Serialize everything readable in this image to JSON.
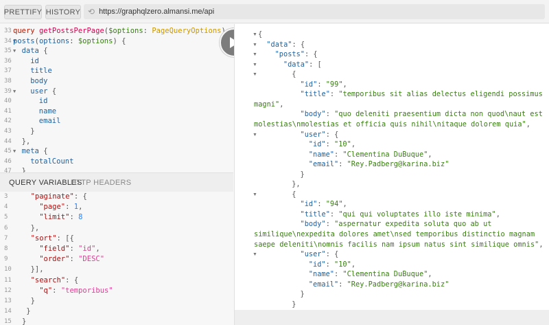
{
  "toolbar": {
    "prettify_label": "PRETTIFY",
    "history_label": "HISTORY",
    "url": "https://graphqlzero.almansi.me/api"
  },
  "query_editor": {
    "lines": [
      {
        "n": "33",
        "fold": "",
        "indent": 0,
        "segs": [
          {
            "c": "kw",
            "t": "query "
          },
          {
            "c": "def",
            "t": "getPostsPerPage"
          },
          {
            "c": "pun",
            "t": "("
          },
          {
            "c": "var",
            "t": "$options"
          },
          {
            "c": "pun",
            "t": ": "
          },
          {
            "c": "type",
            "t": "PageQueryOptions"
          },
          {
            "c": "pun",
            "t": ") {"
          }
        ]
      },
      {
        "n": "34",
        "fold": "▼",
        "indent": 0,
        "segs": [
          {
            "c": "prop",
            "t": "posts"
          },
          {
            "c": "pun",
            "t": "("
          },
          {
            "c": "prop",
            "t": "options"
          },
          {
            "c": "pun",
            "t": ": "
          },
          {
            "c": "var",
            "t": "$options"
          },
          {
            "c": "pun",
            "t": ") {"
          }
        ]
      },
      {
        "n": "35",
        "fold": "▼",
        "indent": 2,
        "segs": [
          {
            "c": "prop",
            "t": "data"
          },
          {
            "c": "pun",
            "t": " {"
          }
        ]
      },
      {
        "n": "36",
        "fold": "",
        "indent": 4,
        "segs": [
          {
            "c": "prop",
            "t": "id"
          }
        ]
      },
      {
        "n": "37",
        "fold": "",
        "indent": 4,
        "segs": [
          {
            "c": "prop",
            "t": "title"
          }
        ]
      },
      {
        "n": "38",
        "fold": "",
        "indent": 4,
        "segs": [
          {
            "c": "prop",
            "t": "body"
          }
        ]
      },
      {
        "n": "39",
        "fold": "▼",
        "indent": 4,
        "segs": [
          {
            "c": "prop",
            "t": "user"
          },
          {
            "c": "pun",
            "t": " {"
          }
        ]
      },
      {
        "n": "40",
        "fold": "",
        "indent": 6,
        "segs": [
          {
            "c": "prop",
            "t": "id"
          }
        ]
      },
      {
        "n": "41",
        "fold": "",
        "indent": 6,
        "segs": [
          {
            "c": "prop",
            "t": "name"
          }
        ]
      },
      {
        "n": "42",
        "fold": "",
        "indent": 6,
        "segs": [
          {
            "c": "prop",
            "t": "email"
          }
        ]
      },
      {
        "n": "43",
        "fold": "",
        "indent": 4,
        "segs": [
          {
            "c": "pun",
            "t": "}"
          }
        ]
      },
      {
        "n": "44",
        "fold": "",
        "indent": 2,
        "segs": [
          {
            "c": "pun",
            "t": "},"
          }
        ]
      },
      {
        "n": "45",
        "fold": "▼",
        "indent": 2,
        "segs": [
          {
            "c": "prop",
            "t": "meta"
          },
          {
            "c": "pun",
            "t": " {"
          }
        ]
      },
      {
        "n": "46",
        "fold": "",
        "indent": 4,
        "segs": [
          {
            "c": "prop",
            "t": "totalCount"
          }
        ]
      },
      {
        "n": "47",
        "fold": "",
        "indent": 2,
        "segs": [
          {
            "c": "pun",
            "t": "}"
          }
        ]
      }
    ]
  },
  "variables": {
    "tab_active": "QUERY VARIABLES",
    "tab_inactive": "HTTP HEADERS",
    "lines": [
      {
        "n": "3",
        "fold": "",
        "indent": 2,
        "segs": [
          {
            "c": "jkey",
            "t": "\"paginate\""
          },
          {
            "c": "pun",
            "t": ": {"
          }
        ]
      },
      {
        "n": "4",
        "fold": "",
        "indent": 4,
        "segs": [
          {
            "c": "jkey",
            "t": "\"page\""
          },
          {
            "c": "pun",
            "t": ": "
          },
          {
            "c": "num",
            "t": "1"
          },
          {
            "c": "pun",
            "t": ","
          }
        ]
      },
      {
        "n": "5",
        "fold": "",
        "indent": 4,
        "segs": [
          {
            "c": "jkey",
            "t": "\"limit\""
          },
          {
            "c": "pun",
            "t": ": "
          },
          {
            "c": "num",
            "t": "8"
          }
        ]
      },
      {
        "n": "6",
        "fold": "",
        "indent": 2,
        "segs": [
          {
            "c": "pun",
            "t": "},"
          }
        ]
      },
      {
        "n": "7",
        "fold": "",
        "indent": 2,
        "segs": [
          {
            "c": "jkey",
            "t": "\"sort\""
          },
          {
            "c": "pun",
            "t": ": [{"
          }
        ]
      },
      {
        "n": "8",
        "fold": "",
        "indent": 4,
        "segs": [
          {
            "c": "jkey",
            "t": "\"field\""
          },
          {
            "c": "pun",
            "t": ": "
          },
          {
            "c": "str",
            "t": "\"id\""
          },
          {
            "c": "pun",
            "t": ","
          }
        ]
      },
      {
        "n": "9",
        "fold": "",
        "indent": 4,
        "segs": [
          {
            "c": "jkey",
            "t": "\"order\""
          },
          {
            "c": "pun",
            "t": ": "
          },
          {
            "c": "str",
            "t": "\"DESC\""
          }
        ]
      },
      {
        "n": "10",
        "fold": "",
        "indent": 2,
        "segs": [
          {
            "c": "pun",
            "t": "}],"
          }
        ]
      },
      {
        "n": "11",
        "fold": "",
        "indent": 2,
        "segs": [
          {
            "c": "jkey",
            "t": "\"search\""
          },
          {
            "c": "pun",
            "t": ": {"
          }
        ]
      },
      {
        "n": "12",
        "fold": "",
        "indent": 4,
        "segs": [
          {
            "c": "jkey",
            "t": "\"q\""
          },
          {
            "c": "pun",
            "t": ": "
          },
          {
            "c": "str",
            "t": "\"temporibus\""
          }
        ]
      },
      {
        "n": "13",
        "fold": "",
        "indent": 2,
        "segs": [
          {
            "c": "pun",
            "t": "}"
          }
        ]
      },
      {
        "n": "14",
        "fold": "",
        "indent": 1,
        "segs": [
          {
            "c": "pun",
            "t": "}"
          }
        ]
      },
      {
        "n": "15",
        "fold": "",
        "indent": 0,
        "segs": [
          {
            "c": "pun",
            "t": "}"
          }
        ]
      }
    ]
  },
  "result": {
    "lines": [
      {
        "fold": "▼",
        "indent": 0,
        "segs": [
          {
            "c": "pun",
            "t": "{"
          }
        ]
      },
      {
        "fold": "▼",
        "indent": 1,
        "segs": [
          {
            "c": "rkey",
            "t": "\"data\""
          },
          {
            "c": "pun",
            "t": ": {"
          }
        ]
      },
      {
        "fold": "▼",
        "indent": 2,
        "segs": [
          {
            "c": "rkey",
            "t": "\"posts\""
          },
          {
            "c": "pun",
            "t": ": {"
          }
        ]
      },
      {
        "fold": "▼",
        "indent": 3,
        "segs": [
          {
            "c": "rkey",
            "t": "\"data\""
          },
          {
            "c": "pun",
            "t": ": ["
          }
        ]
      },
      {
        "fold": "▼",
        "indent": 4,
        "segs": [
          {
            "c": "pun",
            "t": "{"
          }
        ]
      },
      {
        "fold": "",
        "indent": 5,
        "segs": [
          {
            "c": "rkey",
            "t": "\"id\""
          },
          {
            "c": "pun",
            "t": ": "
          },
          {
            "c": "rstr",
            "t": "\"99\""
          },
          {
            "c": "pun",
            "t": ","
          }
        ]
      },
      {
        "fold": "",
        "indent": 5,
        "segs": [
          {
            "c": "rkey",
            "t": "\"title\""
          },
          {
            "c": "pun",
            "t": ": "
          },
          {
            "c": "rstr",
            "t": "\"temporibus sit alias delectus eligendi possimus"
          }
        ]
      },
      {
        "fold": "",
        "indent": -1,
        "segs": [
          {
            "c": "rstr",
            "t": "magni\""
          },
          {
            "c": "pun",
            "t": ","
          }
        ]
      },
      {
        "fold": "",
        "indent": 5,
        "segs": [
          {
            "c": "rkey",
            "t": "\"body\""
          },
          {
            "c": "pun",
            "t": ": "
          },
          {
            "c": "rstr",
            "t": "\"quo deleniti praesentium dicta non quod\\naut est"
          }
        ]
      },
      {
        "fold": "",
        "indent": -1,
        "segs": [
          {
            "c": "rstr",
            "t": "molestias\\nmolestias et officia quis nihil\\nitaque dolorem quia\""
          },
          {
            "c": "pun",
            "t": ","
          }
        ]
      },
      {
        "fold": "▼",
        "indent": 5,
        "segs": [
          {
            "c": "rkey",
            "t": "\"user\""
          },
          {
            "c": "pun",
            "t": ": {"
          }
        ]
      },
      {
        "fold": "",
        "indent": 6,
        "segs": [
          {
            "c": "rkey",
            "t": "\"id\""
          },
          {
            "c": "pun",
            "t": ": "
          },
          {
            "c": "rstr",
            "t": "\"10\""
          },
          {
            "c": "pun",
            "t": ","
          }
        ]
      },
      {
        "fold": "",
        "indent": 6,
        "segs": [
          {
            "c": "rkey",
            "t": "\"name\""
          },
          {
            "c": "pun",
            "t": ": "
          },
          {
            "c": "rstr",
            "t": "\"Clementina DuBuque\""
          },
          {
            "c": "pun",
            "t": ","
          }
        ]
      },
      {
        "fold": "",
        "indent": 6,
        "segs": [
          {
            "c": "rkey",
            "t": "\"email\""
          },
          {
            "c": "pun",
            "t": ": "
          },
          {
            "c": "rstr",
            "t": "\"Rey.Padberg@karina.biz\""
          }
        ]
      },
      {
        "fold": "",
        "indent": 5,
        "segs": [
          {
            "c": "pun",
            "t": "}"
          }
        ]
      },
      {
        "fold": "",
        "indent": 4,
        "segs": [
          {
            "c": "pun",
            "t": "},"
          }
        ]
      },
      {
        "fold": "▼",
        "indent": 4,
        "segs": [
          {
            "c": "pun",
            "t": "{"
          }
        ]
      },
      {
        "fold": "",
        "indent": 5,
        "segs": [
          {
            "c": "rkey",
            "t": "\"id\""
          },
          {
            "c": "pun",
            "t": ": "
          },
          {
            "c": "rstr",
            "t": "\"94\""
          },
          {
            "c": "pun",
            "t": ","
          }
        ]
      },
      {
        "fold": "",
        "indent": 5,
        "segs": [
          {
            "c": "rkey",
            "t": "\"title\""
          },
          {
            "c": "pun",
            "t": ": "
          },
          {
            "c": "rstr",
            "t": "\"qui qui voluptates illo iste minima\""
          },
          {
            "c": "pun",
            "t": ","
          }
        ]
      },
      {
        "fold": "",
        "indent": 5,
        "segs": [
          {
            "c": "rkey",
            "t": "\"body\""
          },
          {
            "c": "pun",
            "t": ": "
          },
          {
            "c": "rstr",
            "t": "\"aspernatur expedita soluta quo ab ut"
          }
        ]
      },
      {
        "fold": "",
        "indent": -1,
        "segs": [
          {
            "c": "rstr",
            "t": "similique\\nexpedita dolores amet\\nsed temporibus distinctio magnam"
          }
        ]
      },
      {
        "fold": "",
        "indent": -1,
        "segs": [
          {
            "c": "rstr",
            "t": "saepe deleniti\\nomnis facilis nam ipsum natus sint similique omnis\""
          },
          {
            "c": "pun",
            "t": ","
          }
        ]
      },
      {
        "fold": "▼",
        "indent": 5,
        "segs": [
          {
            "c": "rkey",
            "t": "\"user\""
          },
          {
            "c": "pun",
            "t": ": {"
          }
        ]
      },
      {
        "fold": "",
        "indent": 6,
        "segs": [
          {
            "c": "rkey",
            "t": "\"id\""
          },
          {
            "c": "pun",
            "t": ": "
          },
          {
            "c": "rstr",
            "t": "\"10\""
          },
          {
            "c": "pun",
            "t": ","
          }
        ]
      },
      {
        "fold": "",
        "indent": 6,
        "segs": [
          {
            "c": "rkey",
            "t": "\"name\""
          },
          {
            "c": "pun",
            "t": ": "
          },
          {
            "c": "rstr",
            "t": "\"Clementina DuBuque\""
          },
          {
            "c": "pun",
            "t": ","
          }
        ]
      },
      {
        "fold": "",
        "indent": 6,
        "segs": [
          {
            "c": "rkey",
            "t": "\"email\""
          },
          {
            "c": "pun",
            "t": ": "
          },
          {
            "c": "rstr",
            "t": "\"Rey.Padberg@karina.biz\""
          }
        ]
      },
      {
        "fold": "",
        "indent": 5,
        "segs": [
          {
            "c": "pun",
            "t": "}"
          }
        ]
      },
      {
        "fold": "",
        "indent": 4,
        "segs": [
          {
            "c": "pun",
            "t": "}"
          }
        ]
      }
    ]
  },
  "icons": {
    "reload": "reload-icon",
    "run": "play-icon"
  }
}
